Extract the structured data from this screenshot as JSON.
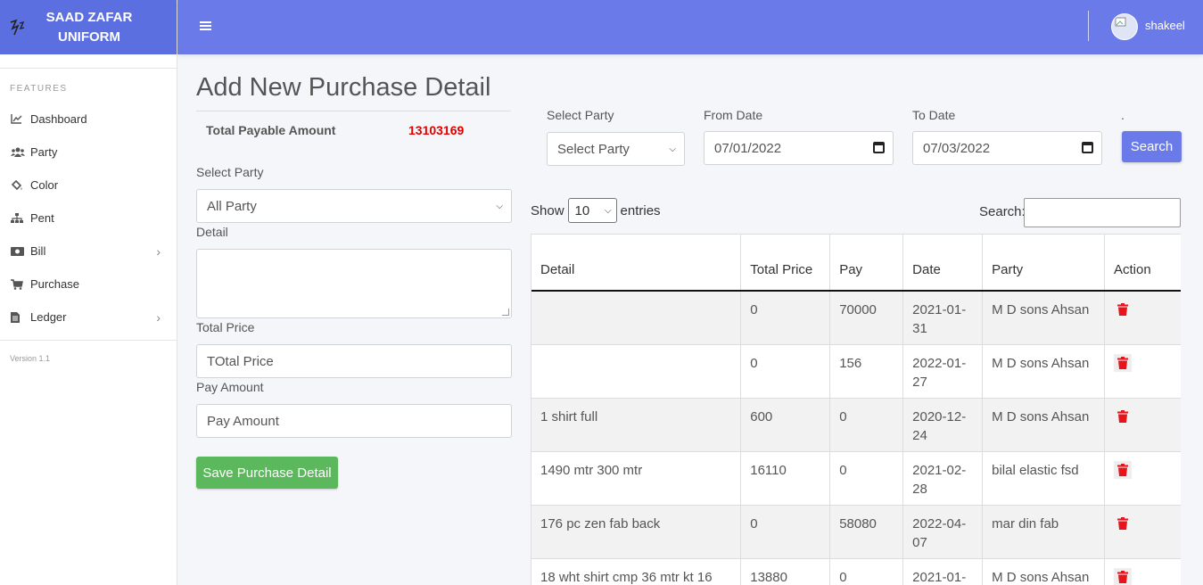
{
  "brand": {
    "line1": "SAAD ZAFAR",
    "line2": "UNIFORM"
  },
  "sidebar": {
    "heading": "FEATURES",
    "items": [
      {
        "label": "Dashboard",
        "icon": "chart-area-icon",
        "has_submenu": false
      },
      {
        "label": "Party",
        "icon": "users-icon",
        "has_submenu": false
      },
      {
        "label": "Color",
        "icon": "paint-bucket-icon",
        "has_submenu": false
      },
      {
        "label": "Pent",
        "icon": "sitemap-icon",
        "has_submenu": false
      },
      {
        "label": "Bill",
        "icon": "money-bill-icon",
        "has_submenu": true
      },
      {
        "label": "Purchase",
        "icon": "cart-icon",
        "has_submenu": false
      },
      {
        "label": "Ledger",
        "icon": "file-icon",
        "has_submenu": true
      }
    ],
    "version": "Version 1.1"
  },
  "topbar": {
    "username": "shakeel"
  },
  "page": {
    "title": "Add New Purchase Detail",
    "total_label": "Total Payable Amount",
    "total_value": "13103169"
  },
  "form": {
    "party_label": "Select Party",
    "party_value": "All Party",
    "detail_label": "Detail",
    "detail_value": "",
    "total_price_label": "Total Price",
    "total_price_placeholder": "TOtal Price",
    "pay_label": "Pay Amount",
    "pay_placeholder": "Pay Amount",
    "save_label": "Save Purchase Detail"
  },
  "filter": {
    "party_label": "Select Party",
    "party_value": "Select Party",
    "from_label": "From Date",
    "from_value": "07/01/2022",
    "to_label": "To Date",
    "to_value": "07/03/2022",
    "dot": ".",
    "search_label": "Search"
  },
  "datatable": {
    "show_label": "Show",
    "page_size": "10",
    "entries_label": "entries",
    "search_label": "Search:",
    "search_value": ""
  },
  "table": {
    "headers": [
      "Detail",
      "Total Price",
      "Pay",
      "Date",
      "Party",
      "Action"
    ],
    "rows": [
      [
        "",
        "0",
        "70000",
        "2021-01-31",
        "M D sons Ahsan"
      ],
      [
        "",
        "0",
        "156",
        "2022-01-27",
        "M D sons Ahsan"
      ],
      [
        "1 shirt full",
        "600",
        "0",
        "2020-12-24",
        "M D sons Ahsan"
      ],
      [
        "1490 mtr 300 mtr",
        "16110",
        "0",
        "2021-02-28",
        "bilal elastic fsd"
      ],
      [
        "176 pc zen fab back",
        "0",
        "58080",
        "2022-04-07",
        "mar din fab"
      ],
      [
        "18 wht shirt cmp 36 mtr kt 16",
        "13880",
        "0",
        "2021-01-",
        "M D sons Ahsan"
      ]
    ]
  },
  "colors": {
    "primary": "#6a7ae9",
    "brand": "#5b6fe0",
    "success": "#5cb85c",
    "danger": "#e00000",
    "trash": "#e8141b"
  }
}
